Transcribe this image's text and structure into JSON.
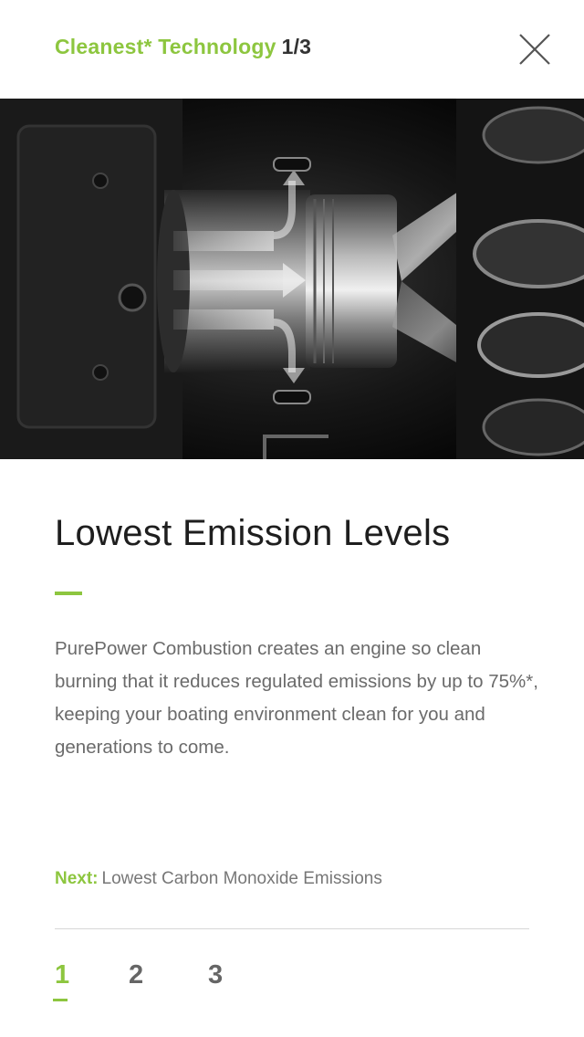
{
  "header": {
    "title": "Cleanest* Technology",
    "counter": "1/3",
    "close_icon": "close-icon"
  },
  "hero": {
    "image": "engine-piston-cutaway-illustration"
  },
  "content": {
    "title": "Lowest Emission Levels",
    "body": "PurePower Combustion creates an engine so clean burning that it reduces regulated emissions by up to 75%*, keeping your boating environment clean for you and generations to come."
  },
  "next": {
    "label": "Next:",
    "text": "Lowest Carbon Monoxide Emissions"
  },
  "pager": {
    "pages": [
      "1",
      "2",
      "3"
    ],
    "active": "1"
  },
  "colors": {
    "accent": "#8dc63f",
    "text_dark": "#1e1e1e",
    "text_body": "#6b6b6b",
    "pager_inactive": "#666666"
  }
}
